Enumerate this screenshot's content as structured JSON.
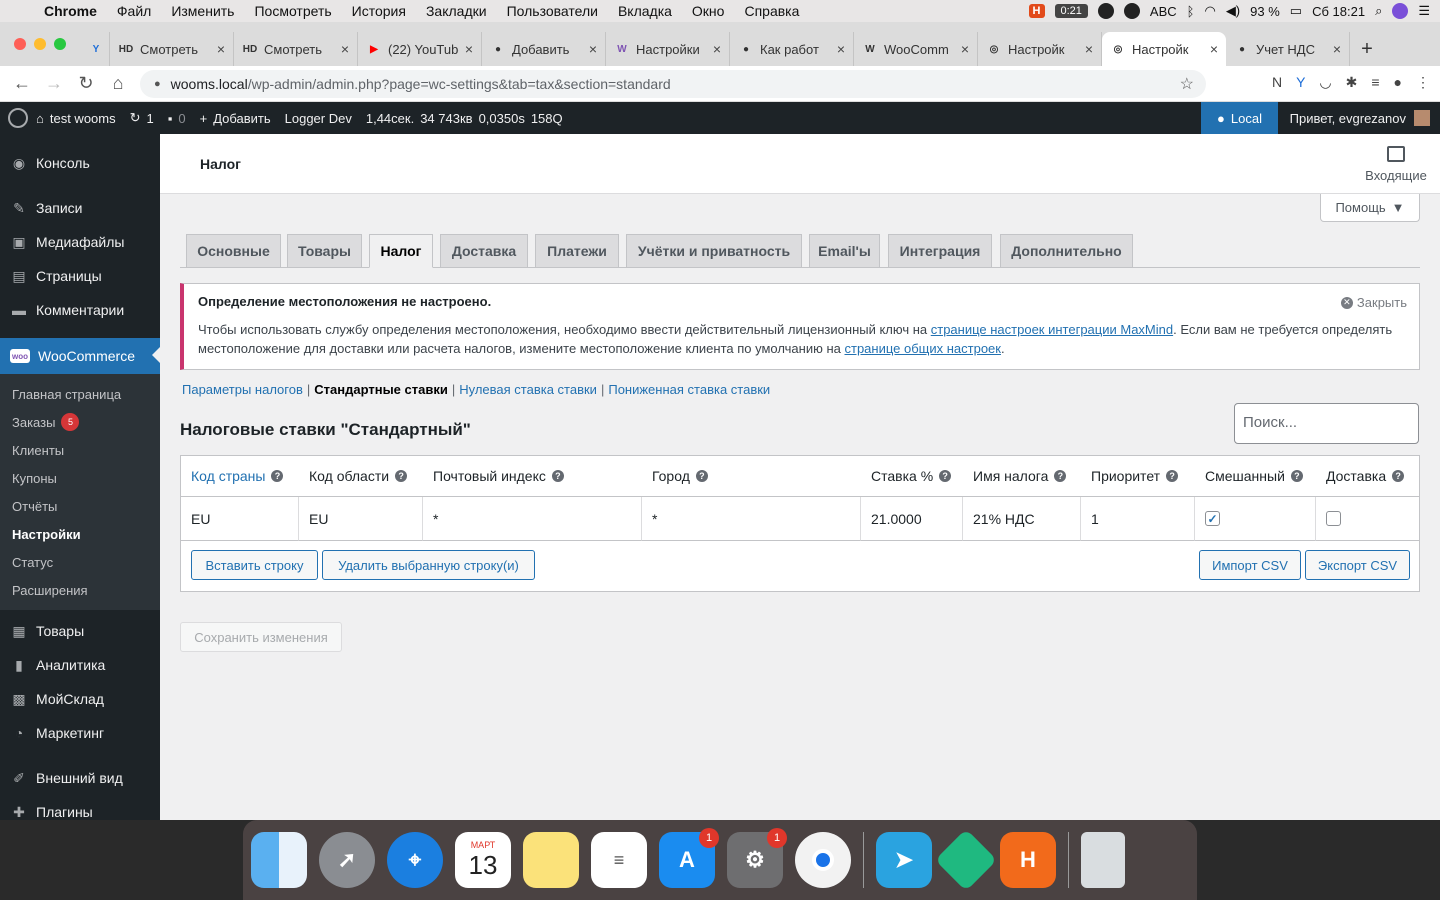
{
  "menubar": {
    "app": "Chrome",
    "items": [
      "Файл",
      "Изменить",
      "Посмотреть",
      "История",
      "Закладки",
      "Пользователи",
      "Вкладка",
      "Окно",
      "Справка"
    ],
    "timer": "0:21",
    "lang": "ABC",
    "battery": "93 %",
    "clock": "Сб 18:21"
  },
  "browser": {
    "tabs": [
      {
        "fav": "Y",
        "title": "",
        "color": "#1e6ed8"
      },
      {
        "fav": "HD",
        "title": "Смотреть",
        "color": "#222"
      },
      {
        "fav": "HD",
        "title": "Смотреть",
        "color": "#222"
      },
      {
        "fav": "▶",
        "title": "(22) YouTube",
        "color": "#ff0000"
      },
      {
        "fav": "●",
        "title": "Добавить",
        "color": "#111"
      },
      {
        "fav": "W",
        "title": "Настройки",
        "color": "#7f54b3"
      },
      {
        "fav": "●",
        "title": "Как работ",
        "color": "#111"
      },
      {
        "fav": "W",
        "title": "WooComm",
        "color": "#555"
      },
      {
        "fav": "◎",
        "title": "Настройк",
        "color": "#555"
      },
      {
        "fav": "◎",
        "title": "Настройк",
        "color": "#555"
      },
      {
        "fav": "●",
        "title": "Учет НДС",
        "color": "#111"
      }
    ],
    "url_host": "wooms.local",
    "url_path": "/wp-admin/admin.php?page=wc-settings&tab=tax&section=standard"
  },
  "adminbar": {
    "site": "test wooms",
    "updates": "1",
    "comments": "0",
    "add": "Добавить",
    "logger": "Logger Dev",
    "stats": [
      "1,44сек.",
      "34 743кв",
      "0,0350s",
      "158Q"
    ],
    "local": "Local",
    "greeting": "Привет, evgrezanov"
  },
  "sidebar": {
    "top": [
      {
        "label": "Консоль",
        "icon": "◉"
      },
      {
        "label": "Записи",
        "icon": "✎"
      },
      {
        "label": "Медиафайлы",
        "icon": "▣"
      },
      {
        "label": "Страницы",
        "icon": "▤"
      },
      {
        "label": "Комментарии",
        "icon": "▬"
      }
    ],
    "woo": "WooCommerce",
    "woo_icon": "woo",
    "sub": [
      "Главная страница",
      "Заказы",
      "Клиенты",
      "Купоны",
      "Отчёты",
      "Настройки",
      "Статус",
      "Расширения"
    ],
    "orders_badge": "5",
    "bottom": [
      {
        "label": "Товары",
        "icon": "▦"
      },
      {
        "label": "Аналитика",
        "icon": "▮"
      },
      {
        "label": "МойСклад",
        "icon": "▩"
      },
      {
        "label": "Маркетинг",
        "icon": "◔"
      },
      {
        "label": "Внешний вид",
        "icon": "✐"
      },
      {
        "label": "Плагины",
        "icon": "✚"
      }
    ]
  },
  "page": {
    "title": "Налог",
    "inbox": "Входящие",
    "help": "Помощь",
    "tabs": [
      "Основные",
      "Товары",
      "Налог",
      "Доставка",
      "Платежи",
      "Учётки и приватность",
      "Email'ы",
      "Интеграция",
      "Дополнительно"
    ],
    "notice_title": "Определение местоположения не настроено.",
    "notice_dismiss": "Закрыть",
    "notice_text1": "Чтобы использовать службу определения местоположения, необходимо ввести действительный лицензионный ключ на ",
    "notice_link1": "странице настроек интеграции MaxMind",
    "notice_text2": ". Если вам не требуется определять местоположение для доставки или расчета налогов, измените местоположение клиента по умолчанию на ",
    "notice_link2": "странице общих настроек",
    "notice_text3": ".",
    "sections": [
      "Параметры налогов",
      "Стандартные ставки",
      "Нулевая ставка ставки",
      "Пониженная ставка ставки"
    ],
    "heading": "Налоговые ставки \"Стандартный\"",
    "search_placeholder": "Поиск...",
    "columns": [
      "Код страны",
      "Код области",
      "Почтовый индекс",
      "Город",
      "Ставка %",
      "Имя налога",
      "Приоритет",
      "Смешанный",
      "Доставка"
    ],
    "row": {
      "country": "EU",
      "state": "EU",
      "postcode": "*",
      "city": "*",
      "rate": "21.0000",
      "name": "21% НДС",
      "priority": "1",
      "compound": true,
      "shipping": false
    },
    "btn_insert": "Вставить строку",
    "btn_delete": "Удалить выбранную строку(и)",
    "btn_import": "Импорт CSV",
    "btn_export": "Экспорт CSV",
    "btn_save": "Сохранить изменения"
  },
  "dock": {
    "calendar_month": "МАРТ",
    "calendar_day": "13",
    "appstore_badge": "1",
    "settings_badge": "1"
  }
}
